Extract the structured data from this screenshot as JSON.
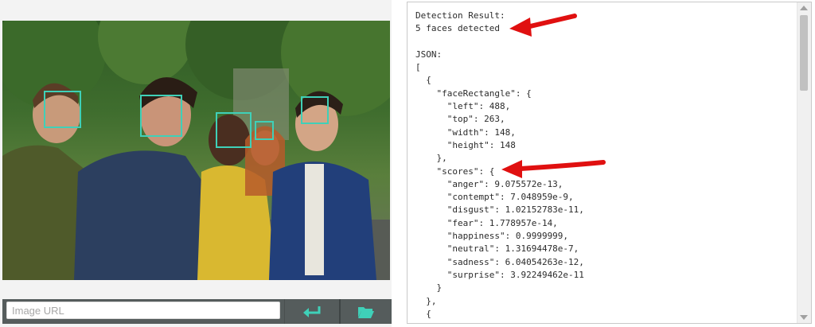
{
  "image_panel": {
    "url_placeholder": "Image URL",
    "submit_icon": "enter-arrow-icon",
    "browse_icon": "folder-open-icon",
    "accent_color": "#3fd0b8",
    "faces_drawn": 5
  },
  "result_panel": {
    "heading": "Detection Result:",
    "summary": "5 faces detected",
    "json_label": "JSON:",
    "json_lines": [
      "[",
      "  {",
      "    \"faceRectangle\": {",
      "      \"left\": 488,",
      "      \"top\": 263,",
      "      \"width\": 148,",
      "      \"height\": 148",
      "    },",
      "    \"scores\": {",
      "      \"anger\": 9.075572e-13,",
      "      \"contempt\": 7.048959e-9,",
      "      \"disgust\": 1.02152783e-11,",
      "      \"fear\": 1.778957e-14,",
      "      \"happiness\": 0.9999999,",
      "      \"neutral\": 1.31694478e-7,",
      "      \"sadness\": 6.04054263e-12,",
      "      \"surprise\": 3.92249462e-11",
      "    }",
      "  },",
      "  {"
    ],
    "annotation_color": "#e01010"
  }
}
